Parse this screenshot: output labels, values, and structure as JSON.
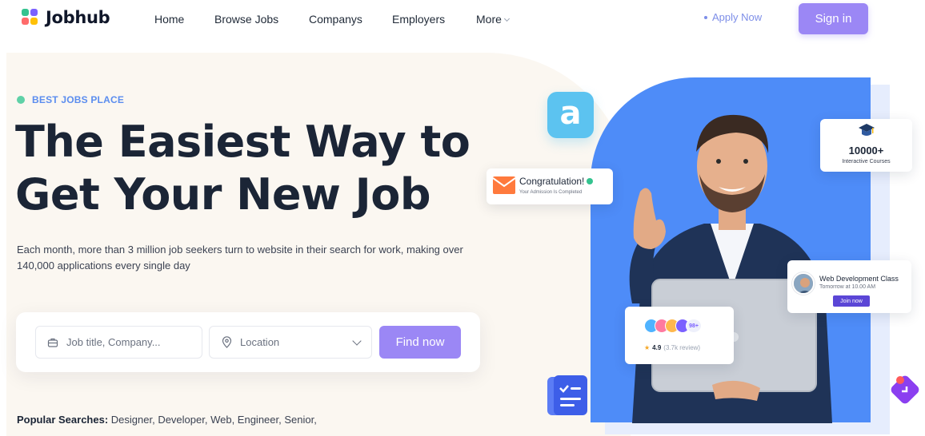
{
  "brand": {
    "name": "Jobhub"
  },
  "nav": {
    "home": "Home",
    "browse": "Browse Jobs",
    "companys": "Companys",
    "employers": "Employers",
    "more": "More"
  },
  "header": {
    "apply_now": "Apply Now",
    "sign_in": "Sign in"
  },
  "hero": {
    "tagline": "BEST JOBS PLACE",
    "headline_line1": "The Easiest Way to",
    "headline_line2": "Get Your New Job",
    "description": "Each month, more than 3 million job seekers turn to website in their search for work, making over 140,000 applications every single day"
  },
  "search": {
    "job_placeholder": "Job title, Company...",
    "location_placeholder": "Location",
    "find_button": "Find now"
  },
  "popular": {
    "label": "Popular Searches:",
    "terms": "Designer, Developer, Web, Engineer, Senior,"
  },
  "cards": {
    "congrats_title": "Congratulation!",
    "congrats_sub": "Your Admission Is Completed",
    "courses_count": "10000+",
    "courses_label": "Interactive Courses",
    "webdev_title": "Web Development Class",
    "webdev_time": "Tomorrow at 10.00 AM",
    "webdev_join": "Join now",
    "reviews_more": "98+",
    "reviews_rating": "4.9",
    "reviews_count": "(3.7k review)"
  },
  "colors": {
    "accent": "#9b87f5",
    "hero_blue": "#4e8cf8",
    "tag_blue": "#5b8def",
    "tag_green": "#5fd1a7"
  }
}
